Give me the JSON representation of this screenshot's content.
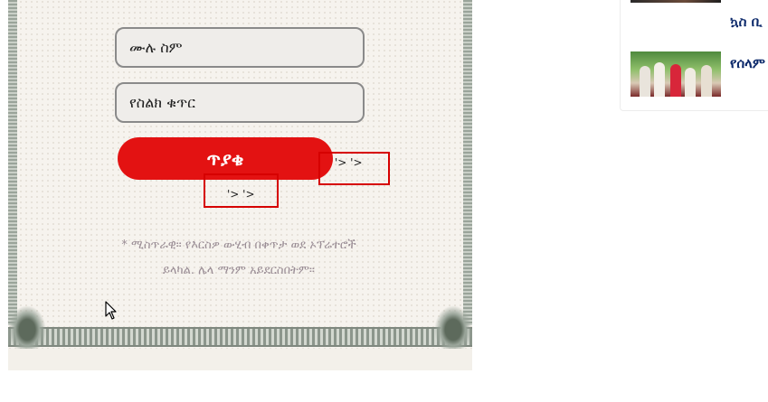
{
  "form": {
    "name_placeholder": "ሙሉ ስም",
    "phone_placeholder": "የስልክ ቁጥር",
    "submit_label": "ጥያቄ",
    "glitch_text_1": "'> '>",
    "glitch_text_2": "'> '>",
    "note_line_1": "* ሚስጥራዊ። የእርስዎ ውሂብ በቀጥታ ወደ ኦፕሬተሮች",
    "note_line_2": "ይላካል. ሌላ ማንም አይደርስበትም።"
  },
  "sidebar": {
    "items": [
      {
        "title": "ኳስ ቢ"
      },
      {
        "title": "የሰላም ምልክት"
      }
    ]
  },
  "colors": {
    "submit": "#e31212",
    "news_title": "#0d2a6b",
    "error_outline": "#d60000"
  }
}
